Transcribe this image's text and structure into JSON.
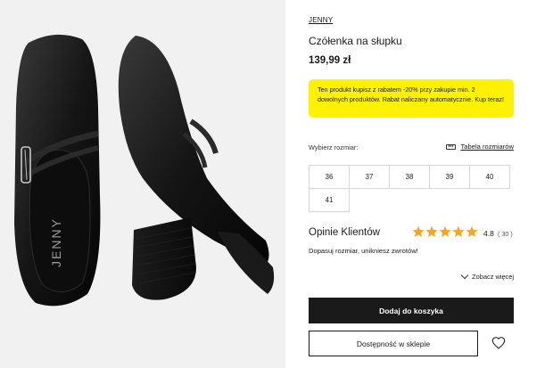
{
  "product": {
    "brand": "JENNY",
    "name": "Czółenka na słupku",
    "price": "139,99 zł",
    "image_text": "JENNY"
  },
  "promo": {
    "text": "Ten produkt kupisz z rabatem -20% przy zakupie min. 2 dowolnych produktów. Rabat naliczany automatycznie. Kup teraz!",
    "color": "#fff200"
  },
  "sizes": {
    "label": "Wybierz rozmiar:",
    "chart_link": "Tabela rozmiarów",
    "chart_icon": "ruler-icon",
    "row1": [
      "36",
      "37",
      "38",
      "39",
      "40"
    ],
    "row2": [
      "41"
    ]
  },
  "reviews": {
    "title": "Opinie Klientów",
    "rating": "4.8",
    "count": "( 30 )",
    "star_count": 5,
    "star_color": "#f5a623",
    "fit_message": "Dopasuj rozmiar, unikniesz zwrotów!",
    "see_more": "Zobacz więcej"
  },
  "actions": {
    "add_to_cart": "Dodaj do koszyka",
    "availability": "Dostępność w sklepie",
    "wishlist_icon": "heart-icon"
  }
}
